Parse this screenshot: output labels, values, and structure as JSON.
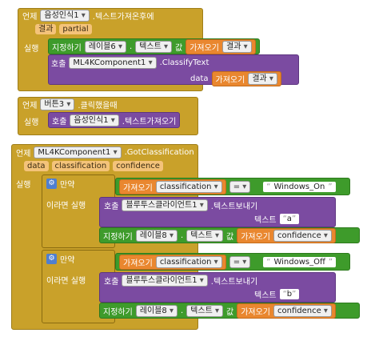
{
  "block1": {
    "when": "언제",
    "component": "음성인식1",
    "event": ".텍스트가져온후에",
    "params": [
      "결과",
      "partial"
    ],
    "do": "실행",
    "set_label": "지정하기",
    "set_component": "레이블6",
    "dot": ".",
    "set_prop": "텍스트",
    "value_label": "값",
    "get_label": "가져오기",
    "get_var": "결과",
    "call_label": "호출",
    "call_component": "ML4KComponent1",
    "call_method": ".ClassifyText",
    "arg_label": "data",
    "arg_get_label": "가져오기",
    "arg_var": "결과"
  },
  "block2": {
    "when": "언제",
    "component": "버튼3",
    "event": ".클릭했을때",
    "do": "실행",
    "call_label": "호출",
    "call_component": "음성인식1",
    "call_method": ".텍스트가져오기"
  },
  "block3": {
    "when": "언제",
    "component": "ML4KComponent1",
    "event": ".GotClassification",
    "params": [
      "data",
      "classification",
      "confidence"
    ],
    "do": "실행",
    "if_label": "만약",
    "then_label": "이라면 실행",
    "branches": [
      {
        "compare_get_label": "가져오기",
        "compare_var": "classification",
        "op": "=",
        "compare_value": "Windows_On",
        "call_label": "호출",
        "call_component": "블루투스클라이언트1",
        "call_method": ".텍스트보내기",
        "arg_label": "텍스트",
        "arg_value": "a",
        "set_label": "지정하기",
        "set_component": "레이블8",
        "dot": ".",
        "set_prop": "텍스트",
        "value_label": "값",
        "get_label": "가져오기",
        "get_var": "confidence"
      },
      {
        "compare_get_label": "가져오기",
        "compare_var": "classification",
        "op": "=",
        "compare_value": "Windows_Off",
        "call_label": "호출",
        "call_component": "블루투스클라이언트1",
        "call_method": ".텍스트보내기",
        "arg_label": "텍스트",
        "arg_value": "b",
        "set_label": "지정하기",
        "set_component": "레이블8",
        "dot": ".",
        "set_prop": "텍스트",
        "value_label": "값",
        "get_label": "가져오기",
        "get_var": "confidence"
      }
    ]
  }
}
